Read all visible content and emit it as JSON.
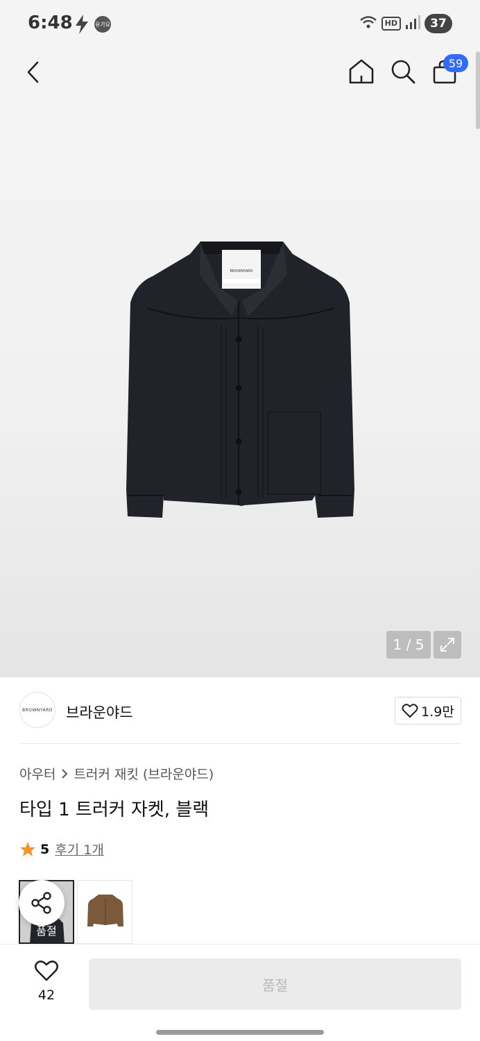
{
  "status_bar": {
    "time": "6:48",
    "badge": "유가요",
    "hd": "HD",
    "battery": "37",
    "icons": [
      "bolt-icon",
      "wifi-icon",
      "signal-icon"
    ]
  },
  "header": {
    "cart_count": "59",
    "icons": [
      "back-icon",
      "home-icon",
      "search-icon",
      "cart-icon"
    ]
  },
  "gallery": {
    "counter": "1 / 5",
    "icons": [
      "expand-icon"
    ],
    "jacket_tag": "BROWNYARD"
  },
  "brand": {
    "logo_text": "BROWNYARD",
    "name": "브라운야드",
    "likes": "1.9만"
  },
  "product": {
    "breadcrumb": [
      "아우터",
      "트러커 재킷 (브라운야드)"
    ],
    "title": "타입 1 트러커 자켓, 블랙",
    "rating": "5",
    "reviews_link": "후기 1개",
    "star_color": "#f7931e"
  },
  "variants": [
    {
      "color": "black",
      "label": "품절"
    },
    {
      "color": "brown",
      "label": ""
    }
  ],
  "bottom": {
    "wish_count": "42",
    "buy_label": "품절"
  }
}
